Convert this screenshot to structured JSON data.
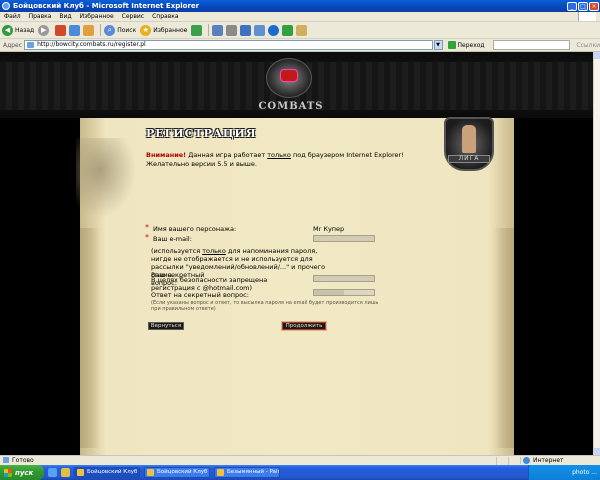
{
  "window": {
    "title": "Бойцовский Клуб - Microsoft Internet Explorer",
    "min_glyph": "_",
    "max_glyph": "□",
    "close_glyph": "×"
  },
  "menu": [
    "Файл",
    "Правка",
    "Вид",
    "Избранное",
    "Сервис",
    "Справка"
  ],
  "toolbar": {
    "back_label": "Назад",
    "search_label": "Поиск",
    "favorites_label": "Избранное",
    "back_glyph": "◀",
    "forward_glyph": "▶",
    "search_glyph": "⌕",
    "favorites_glyph": "★"
  },
  "address": {
    "label": "Адрес",
    "url": "http://bowcity.combats.ru/register.pl",
    "dropdown_glyph": "▼",
    "go_label": "Переход",
    "links_label": "Ссылки"
  },
  "site": {
    "logo_text": "COMBATS",
    "emblem_text": "ЛИГА",
    "page_title": "РЕГИСТРАЦИЯ",
    "warning_strong": "Внимание!",
    "warning_a": " Данная игра работает ",
    "warning_under": "только",
    "warning_b": " под браузером Internet Explorer! Желательно версии 5.5 и выше."
  },
  "form": {
    "required_mark": "*",
    "name_label": "Имя вашего персонажа:",
    "name_value": "Mr Купер",
    "email_label": "Ваш e-mail:",
    "help_a": "(используется ",
    "help_under": "только",
    "help_b": " для напоминания пароля, нигде не отображается и не используется для рассылки \"уведомлений/обновлений/...\" и прочего спама.",
    "help_c": "В целях безопасности запрещена регистрация с @hotmail.com)",
    "secret_q_label": "Ваш секретный вопрос:",
    "secret_a_label": "Ответ на секретный вопрос:",
    "note": "(Если указаны вопрос и ответ, то высылка пароля на email будет производится лишь при правильном ответе)",
    "back_button": "Вернуться",
    "continue_button": "Продолжить"
  },
  "status": {
    "text": "Готово",
    "zone": "Интернет"
  },
  "taskbar": {
    "start": "пуск",
    "tasks": [
      "Бойцовский Клуб - ...",
      "Бойцовский Клуб (М...",
      "Безымянный - Paint"
    ],
    "clock": "photo ..."
  }
}
